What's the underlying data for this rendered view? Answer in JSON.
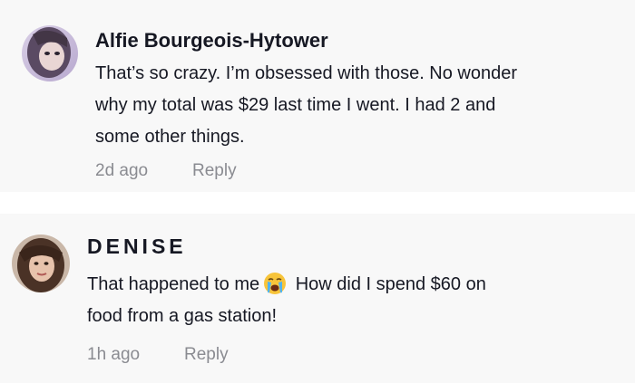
{
  "comments": [
    {
      "username": "Alfie Bourgeois-Hytower",
      "text_lines": [
        "That’s so crazy. I’m obsessed with those. No wonder",
        "why my total was $29 last time I went. I had 2 and",
        "some other things."
      ],
      "time": "2d ago",
      "reply_label": "Reply",
      "avatar_icon": "user-avatar"
    },
    {
      "username": "DENISE",
      "text_part1": "That happened to me",
      "emoji_icon": "loudly-crying-face-emoji",
      "text_part2": " How did I spend $60 on",
      "text_line2": "food from a gas station!",
      "time": "1h ago",
      "reply_label": "Reply",
      "avatar_icon": "user-avatar"
    }
  ]
}
